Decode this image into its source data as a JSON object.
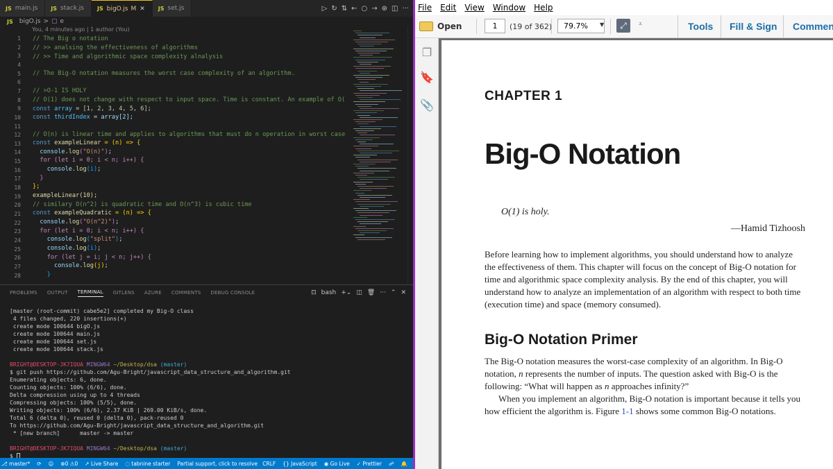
{
  "vscode": {
    "tabs": [
      {
        "icon": "JS",
        "label": "main.js",
        "active": false
      },
      {
        "icon": "JS",
        "label": "stack.js",
        "active": false
      },
      {
        "icon": "JS",
        "label": "bigO.js",
        "active": true,
        "modified": "M",
        "close": "✕"
      },
      {
        "icon": "JS",
        "label": "set.js",
        "active": false
      }
    ],
    "breadcrumb": {
      "icon": "JS",
      "file": "bigO.js",
      "sep": ">",
      "symbol": "e"
    },
    "blame": "You, 4 minutes ago | 1 author (You)",
    "lines": [
      "1",
      "2",
      "3",
      "4",
      "5",
      "6",
      "7",
      "8",
      "9",
      "10",
      "11",
      "12",
      "13",
      "14",
      "15",
      "16",
      "17",
      "18",
      "19",
      "20",
      "21",
      "22",
      "23",
      "24",
      "25",
      "26",
      "27",
      "28"
    ],
    "code": {
      "c1": "// The Big o notation",
      "c2": "// >> analsing the effectiveness of algorithms",
      "c3": "// >> Time and algorithmic space complexity alnalysis",
      "c5": "// The Big-O notation measures the worst case complexity of an algorithm.",
      "c7": "// >O-1 IS HOLY",
      "c8": "// O(1) does not change with respect to input space. Time is constant. An example of O(",
      "c12": "// O(n) is linear time and applies to algorithms that must do n operation in worst case",
      "c20": "// similary O(n^2) is quadratic time and O(n^3) is cubic time",
      "kw_const": "const",
      "array": "array",
      "arr_vals": "[1, 2, 3, 4, 5, 6];",
      "thirdIndex": "thirdIndex",
      "arr_idx": "array[2];",
      "exampleLinear": "exampleLinear",
      "exampleQuadratic": "exampleQuadratic",
      "arrow": "= (n) => {",
      "console": "console",
      "log": "log",
      "s_on": "\"O(n)\"",
      "s_on2": "\"O(n^2)\"",
      "s_split": "\"split\"",
      "for1": "for (let i = 0; i < n; i++) {",
      "for2": "for (let j = i; j < n; j++) {",
      "close_brace": "}",
      "close_semi": "};",
      "call_linear": "exampleLinear(10);"
    },
    "panel_tabs": [
      "PROBLEMS",
      "OUTPUT",
      "TERMINAL",
      "GITLENS",
      "AZURE",
      "COMMENTS",
      "DEBUG CONSOLE"
    ],
    "panel_active": "TERMINAL",
    "shell": "bash",
    "terminal": {
      "l1": "[master (root-commit) cabe5e2] completed my Big-O class",
      "l2": " 4 files changed, 220 insertions(+)",
      "l3": " create mode 100644 bigO.js",
      "l4": " create mode 100644 main.js",
      "l5": " create mode 100644 set.js",
      "l6": " create mode 100644 stack.js",
      "user": "BRIGHT@DESKTOP-JK7IQUA",
      "mingw": "MINGW64",
      "path": "~/Desktop/dsa",
      "branch": "(master)",
      "l8": "$ git push https://github.com/Agu-Bright/javascript_data_structure_and_algorithm.git",
      "l9": "Enumerating objects: 6, done.",
      "l10": "Counting objects: 100% (6/6), done.",
      "l11": "Delta compression using up to 4 threads",
      "l12": "Compressing objects: 100% (5/5), done.",
      "l13": "Writing objects: 100% (6/6), 2.37 KiB | 269.00 KiB/s, done.",
      "l14": "Total 6 (delta 0), reused 0 (delta 0), pack-reused 0",
      "l15": "To https://github.com/Agu-Bright/javascript_data_structure_and_algorithm.git",
      "l16": " * [new branch]      master -> master",
      "prompt": "$ "
    },
    "status": {
      "branch": "master*",
      "problems": "⊗0 ⚠0",
      "liveshare": "Live Share",
      "tabnine": "tabnine starter",
      "partial": "Partial support, click to resolve",
      "eol": "CRLF",
      "lang": "{} JavaScript",
      "golive": "Go Live",
      "prettier": "✓ Prettier"
    }
  },
  "acrobat": {
    "menu": [
      "File",
      "Edit",
      "View",
      "Window",
      "Help"
    ],
    "open_label": "Open",
    "page": "1",
    "page_count": "(19 of 362)",
    "zoom": "79.7%",
    "right_tabs": [
      "Tools",
      "Fill & Sign",
      "Commen"
    ],
    "document": {
      "chapter": "CHAPTER 1",
      "title": "Big-O Notation",
      "epigraph": "O(1) is holy.",
      "epigraph_author": "—Hamid Tizhoosh",
      "para1": "Before learning how to implement algorithms, you should understand how to analyze the effectiveness of them. This chapter will focus on the concept of Big-O notation for time and algorithmic space complexity analysis. By the end of this chapter, you will understand how to analyze an implementation of an algorithm with respect to both time (execution time) and space (memory consumed).",
      "heading": "Big-O Notation Primer",
      "para2a": "The Big-O notation measures the worst-case complexity of an algorithm. In Big-O notation, ",
      "para2n": "n",
      "para2b": " represents the number of inputs. The question asked with Big-O is the following: “What will happen as ",
      "para2n2": "n",
      "para2c": " approaches infinity?”",
      "para3a": "When you implement an algorithm, Big-O notation is important because it tells you how efficient the algorithm is. Figure ",
      "para3link": "1-1",
      "para3b": " shows some common Big-O notations."
    }
  },
  "colors": {
    "accent": "#007acc",
    "divider": "#9b30c0",
    "link": "#2a4cc9"
  }
}
